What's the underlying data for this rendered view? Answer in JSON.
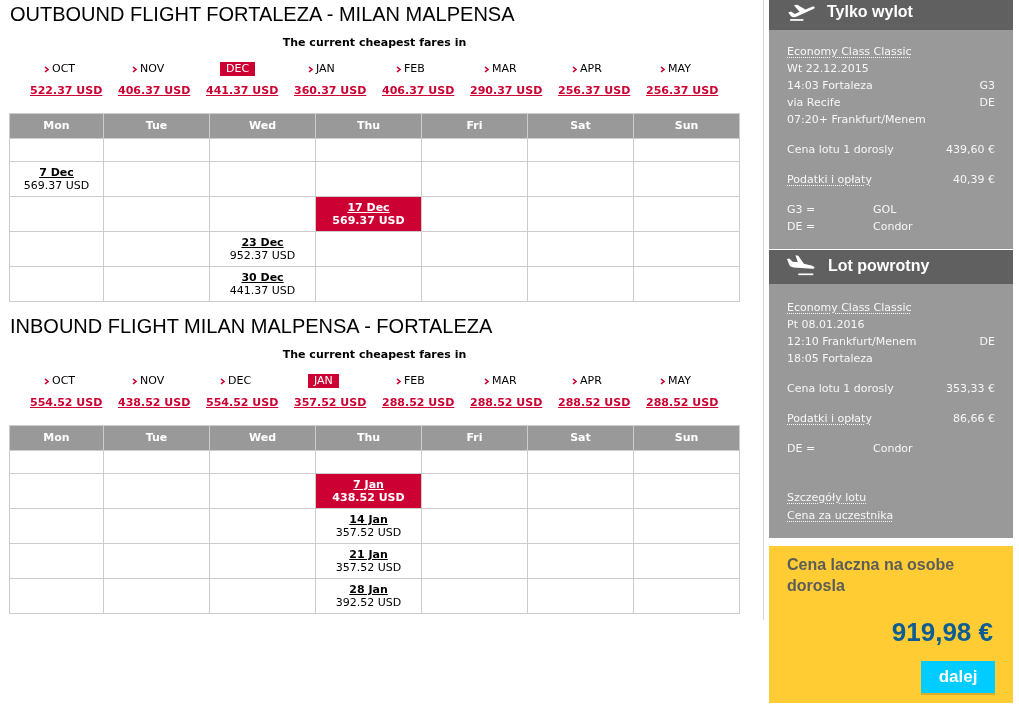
{
  "sections": [
    {
      "title": "OUTBOUND FLIGHT FORTALEZA - MILAN MALPENSA",
      "fares_label": "The current cheapest fares in",
      "months": [
        {
          "label": "OCT",
          "price": "522.37 USD",
          "selected": false
        },
        {
          "label": "NOV",
          "price": "406.37 USD",
          "selected": false
        },
        {
          "label": "DEC",
          "price": "441.37 USD",
          "selected": true
        },
        {
          "label": "JAN",
          "price": "360.37 USD",
          "selected": false
        },
        {
          "label": "FEB",
          "price": "406.37 USD",
          "selected": false
        },
        {
          "label": "MAR",
          "price": "290.37 USD",
          "selected": false
        },
        {
          "label": "APR",
          "price": "256.37 USD",
          "selected": false
        },
        {
          "label": "MAY",
          "price": "256.37 USD",
          "selected": false
        }
      ],
      "calendar": {
        "columns": [
          "Mon",
          "Tue",
          "Wed",
          "Thu",
          "Fri",
          "Sat",
          "Sun"
        ],
        "rows": [
          [
            null,
            null,
            null,
            null,
            null,
            null,
            null
          ],
          [
            {
              "date": "7 Dec",
              "price": "569.37 USD",
              "selected": false
            },
            null,
            null,
            null,
            null,
            null,
            null
          ],
          [
            null,
            null,
            null,
            {
              "date": "17 Dec",
              "price": "569.37 USD",
              "selected": true
            },
            null,
            null,
            null
          ],
          [
            null,
            null,
            {
              "date": "23 Dec",
              "price": "952.37 USD",
              "selected": false
            },
            null,
            null,
            null,
            null
          ],
          [
            null,
            null,
            {
              "date": "30 Dec",
              "price": "441.37 USD",
              "selected": false
            },
            null,
            null,
            null,
            null
          ]
        ]
      }
    },
    {
      "title": "INBOUND FLIGHT MILAN MALPENSA - FORTALEZA",
      "fares_label": "The current cheapest fares in",
      "months": [
        {
          "label": "OCT",
          "price": "554.52 USD",
          "selected": false
        },
        {
          "label": "NOV",
          "price": "438.52 USD",
          "selected": false
        },
        {
          "label": "DEC",
          "price": "554.52 USD",
          "selected": false
        },
        {
          "label": "JAN",
          "price": "357.52 USD",
          "selected": true
        },
        {
          "label": "FEB",
          "price": "288.52 USD",
          "selected": false
        },
        {
          "label": "MAR",
          "price": "288.52 USD",
          "selected": false
        },
        {
          "label": "APR",
          "price": "288.52 USD",
          "selected": false
        },
        {
          "label": "MAY",
          "price": "288.52 USD",
          "selected": false
        }
      ],
      "calendar": {
        "columns": [
          "Mon",
          "Tue",
          "Wed",
          "Thu",
          "Fri",
          "Sat",
          "Sun"
        ],
        "rows": [
          [
            null,
            null,
            null,
            null,
            null,
            null,
            null
          ],
          [
            null,
            null,
            null,
            {
              "date": "7 Jan",
              "price": "438.52 USD",
              "selected": true
            },
            null,
            null,
            null
          ],
          [
            null,
            null,
            null,
            {
              "date": "14 Jan",
              "price": "357.52 USD",
              "selected": false
            },
            null,
            null,
            null
          ],
          [
            null,
            null,
            null,
            {
              "date": "21 Jan",
              "price": "357.52 USD",
              "selected": false
            },
            null,
            null,
            null
          ],
          [
            null,
            null,
            null,
            {
              "date": "28 Jan",
              "price": "392.52 USD",
              "selected": false
            },
            null,
            null,
            null
          ]
        ]
      }
    }
  ],
  "sidebar": {
    "flights": [
      {
        "kind": "departure",
        "title": "Tylko wylot",
        "fare_class": "Economy Class Classic",
        "date": "Wt 22.12.2015",
        "segments": [
          {
            "text": "14:03 Fortaleza",
            "code": "G3"
          },
          {
            "text": "via Recife",
            "code": "DE"
          },
          {
            "text": "07:20+ Frankfurt/Menem"
          }
        ],
        "fare": {
          "label": "Cena lotu 1 dorosly",
          "value": "439,60 €"
        },
        "taxes": {
          "label": "Podatki i opłaty",
          "value": "40,39 €"
        },
        "carriers": [
          {
            "code": "G3 =",
            "name": "GOL"
          },
          {
            "code": "DE =",
            "name": "Condor"
          }
        ]
      },
      {
        "kind": "return",
        "title": "Lot powrotny",
        "fare_class": "Economy Class Classic",
        "date": "Pt 08.01.2016",
        "segments": [
          {
            "text": "12:10 Frankfurt/Menem",
            "code": "DE"
          },
          {
            "text": "18:05 Fortaleza"
          }
        ],
        "fare": {
          "label": "Cena lotu 1 dorosly",
          "value": "353,33 €"
        },
        "taxes": {
          "label": "Podatki i opłaty",
          "value": "86,66 €"
        },
        "carriers": [
          {
            "code": "DE =",
            "name": "Condor"
          }
        ],
        "links": [
          "Szczegóły lotu",
          "Cena za uczestnika"
        ]
      }
    ]
  },
  "total": {
    "label": "Cena laczna na osobe dorosla",
    "price": "919,98 €",
    "button": "dalej"
  }
}
